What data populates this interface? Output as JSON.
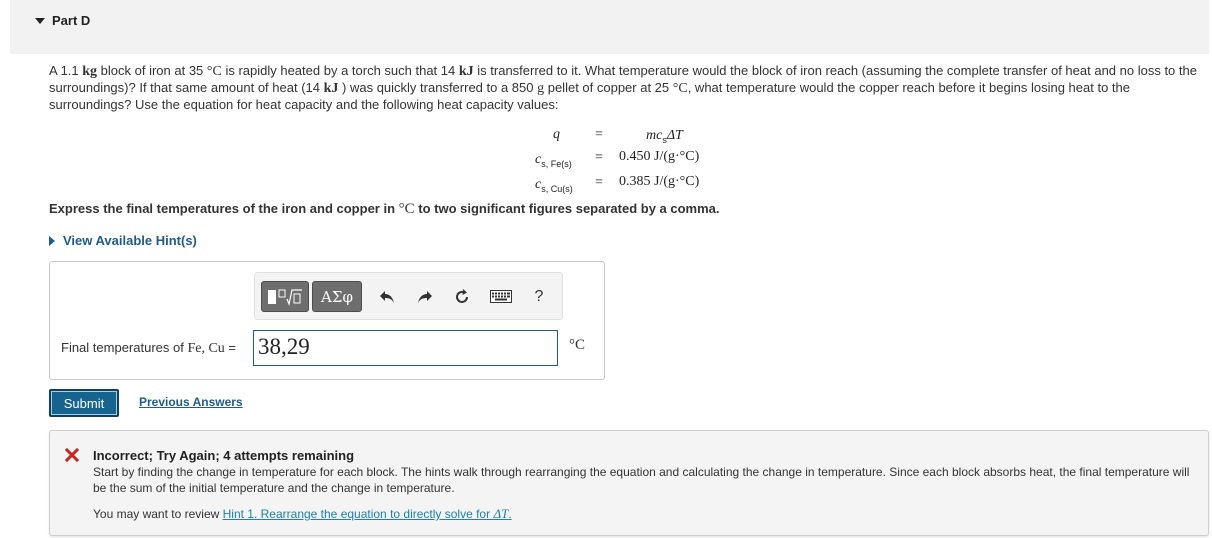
{
  "part": {
    "title": "Part D"
  },
  "problem": {
    "p1": "A 1.1 ",
    "u_kg": "kg",
    "p2": " block of iron at 35 ",
    "u_c1": "°C",
    "p3": " is rapidly heated by a torch such that 14 ",
    "u_kj1": "kJ",
    "p4": " is transferred to it. What temperature would the block of iron reach (assuming the complete transfer of heat and no loss to the surroundings)? If that same amount of heat (14 ",
    "u_kj2": "kJ",
    "p5": " ) was quickly transferred to a 850 ",
    "u_g": "g",
    "p6": " pellet of copper at 25 ",
    "u_c2": "°C",
    "p7": ", what temperature would the copper reach before it begins losing heat to the surroundings? Use the equation for heat capacity and the following heat capacity values:"
  },
  "equations": {
    "eq1_lhs": "q",
    "eq1_rhs_m": "mc",
    "eq1_rhs_sub": "s",
    "eq1_rhs_dt": "ΔT",
    "eq2_lhs": "c",
    "eq2_sub": "s, Fe(s)",
    "eq2_rhs": "0.450 J/(g·°C)",
    "eq3_lhs": "c",
    "eq3_sub": "s, Cu(s)",
    "eq3_rhs": "0.385 J/(g·°C)",
    "equals": "="
  },
  "instruction": {
    "before": "Express the final temperatures of the iron and copper in ",
    "unit": "°C",
    "after": " to two significant figures separated by a comma."
  },
  "hints": {
    "label": "View Available Hint(s)"
  },
  "toolbar": {
    "symbols_label": "ΑΣφ",
    "help_label": "?"
  },
  "answer": {
    "label_prefix": "Final temperatures of ",
    "label_vars": "Fe, Cu",
    "label_suffix": " = ",
    "value": "38,29",
    "unit": "°C"
  },
  "actions": {
    "submit": "Submit",
    "previous_answers": "Previous Answers"
  },
  "feedback": {
    "title": "Incorrect; Try Again; 4 attempts remaining",
    "body": "Start by finding the change in temperature for each block. The hints walk through rearranging the equation and calculating the change in temperature. Since each block absorbs heat, the final temperature will be the sum of the initial temperature and the change in temperature.",
    "review_prefix": "You may want to review ",
    "hint_link": "Hint 1. Rearrange the equation to directly solve for ",
    "hint_var": "ΔT",
    "hint_end": ".",
    "icon_color": "#cc2222"
  },
  "colors": {
    "link": "#1e5c8a",
    "submit_bg": "#17638f",
    "header_bg": "#f2f2f2",
    "error": "#cc2222"
  }
}
